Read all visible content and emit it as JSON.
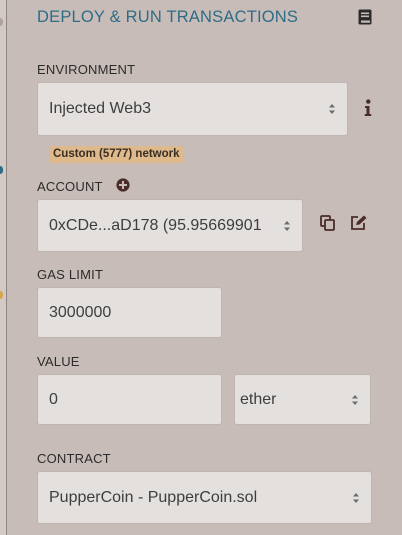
{
  "header": {
    "title": "DEPLOY & RUN TRANSACTIONS",
    "book_icon": "book-icon"
  },
  "environment": {
    "label": "ENVIRONMENT",
    "selected": "Injected Web3",
    "info_icon": "info-icon",
    "network_badge": "Custom (5777) network"
  },
  "account": {
    "label": "ACCOUNT",
    "add_icon": "plus-circle-icon",
    "selected": "0xCDe...aD178 (95.95669901",
    "copy_icon": "copy-icon",
    "edit_icon": "edit-icon"
  },
  "gas_limit": {
    "label": "GAS LIMIT",
    "value": "3000000"
  },
  "value": {
    "label": "VALUE",
    "amount": "0",
    "unit": "ether"
  },
  "contract": {
    "label": "CONTRACT",
    "selected": "PupperCoin - PupperCoin.sol"
  },
  "colors": {
    "background": "#c8bcb8",
    "title": "#2f6c86",
    "field_bg": "#e3e0de",
    "badge_bg": "#ddb98c",
    "icon_dark": "#4a2c2a"
  }
}
